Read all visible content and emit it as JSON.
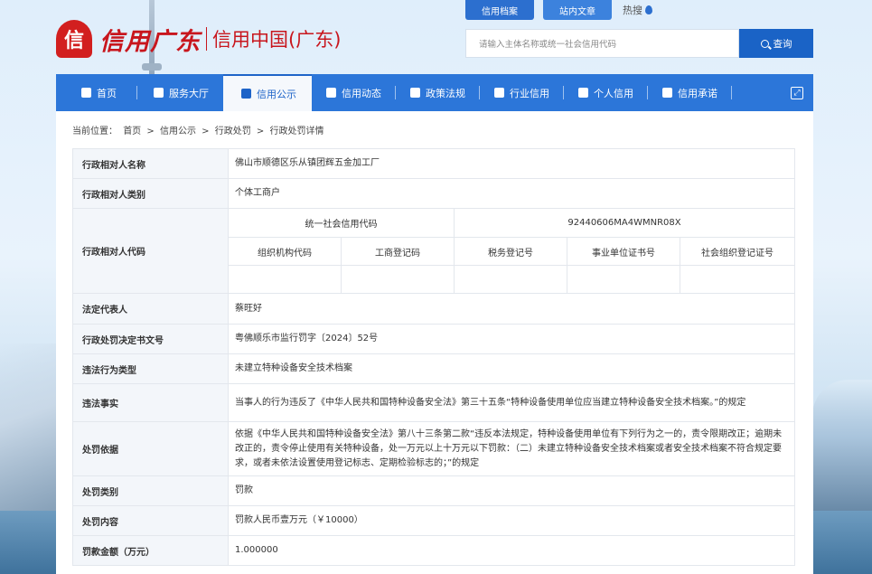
{
  "header": {
    "logo_cn": "信用广东",
    "logo_sub": "信用中国(广东)",
    "logo_mark": "信",
    "top_tabs": [
      "信用档案",
      "站内文章"
    ],
    "hot": "热搜",
    "search_placeholder": "请输入主体名称或统一社会信用代码",
    "search_button": "查询"
  },
  "nav": {
    "items": [
      {
        "label": "首页",
        "icon": "home-icon"
      },
      {
        "label": "服务大厅",
        "icon": "grid-icon"
      },
      {
        "label": "信用公示",
        "icon": "bulletin-icon"
      },
      {
        "label": "信用动态",
        "icon": "news-icon"
      },
      {
        "label": "政策法规",
        "icon": "law-icon"
      },
      {
        "label": "行业信用",
        "icon": "building-icon"
      },
      {
        "label": "个人信用",
        "icon": "person-icon"
      },
      {
        "label": "信用承诺",
        "icon": "shield-icon"
      }
    ],
    "active": "信用公示"
  },
  "breadcrumb": {
    "prefix": "当前位置：",
    "items": [
      "首页",
      "信用公示",
      "行政处罚",
      "行政处罚详情"
    ],
    "sep": ">"
  },
  "detail": {
    "name_label": "行政相对人名称",
    "name_value": "佛山市顺德区乐从镇团辉五金加工厂",
    "type_label": "行政相对人类别",
    "type_value": "个体工商户",
    "code_label": "行政相对人代码",
    "code_headers": {
      "uscc": "统一社会信用代码",
      "org": "组织机构代码",
      "biz": "工商登记码",
      "tax": "税务登记号",
      "inst": "事业单位证书号",
      "social": "社会组织登记证号"
    },
    "code_values": {
      "uscc": "92440606MA4WMNR08X",
      "org": "",
      "biz": "",
      "tax": "",
      "inst": "",
      "social": ""
    },
    "legal_label": "法定代表人",
    "legal_value": "蔡旺好",
    "doc_label": "行政处罚决定书文号",
    "doc_value": "粤佛顺乐市监行罚字〔2024〕52号",
    "violation_type_label": "违法行为类型",
    "violation_type_value": "未建立特种设备安全技术档案",
    "facts_label": "违法事实",
    "facts_value": "当事人的行为违反了《中华人民共和国特种设备安全法》第三十五条“特种设备使用单位应当建立特种设备安全技术档案。”的规定",
    "basis_label": "处罚依据",
    "basis_value": "依据《中华人民共和国特种设备安全法》第八十三条第二款“违反本法规定，特种设备使用单位有下列行为之一的，责令限期改正；逾期未改正的，责令停止使用有关特种设备，处一万元以上十万元以下罚款：（二）未建立特种设备安全技术档案或者安全技术档案不符合规定要求，或者未依法设置使用登记标志、定期检验标志的；”的规定",
    "category_label": "处罚类别",
    "category_value": "罚款",
    "content_label": "处罚内容",
    "content_value": "罚款人民币壹万元（￥10000）",
    "amount_label": "罚款金额（万元）",
    "amount_value": "1.000000"
  }
}
